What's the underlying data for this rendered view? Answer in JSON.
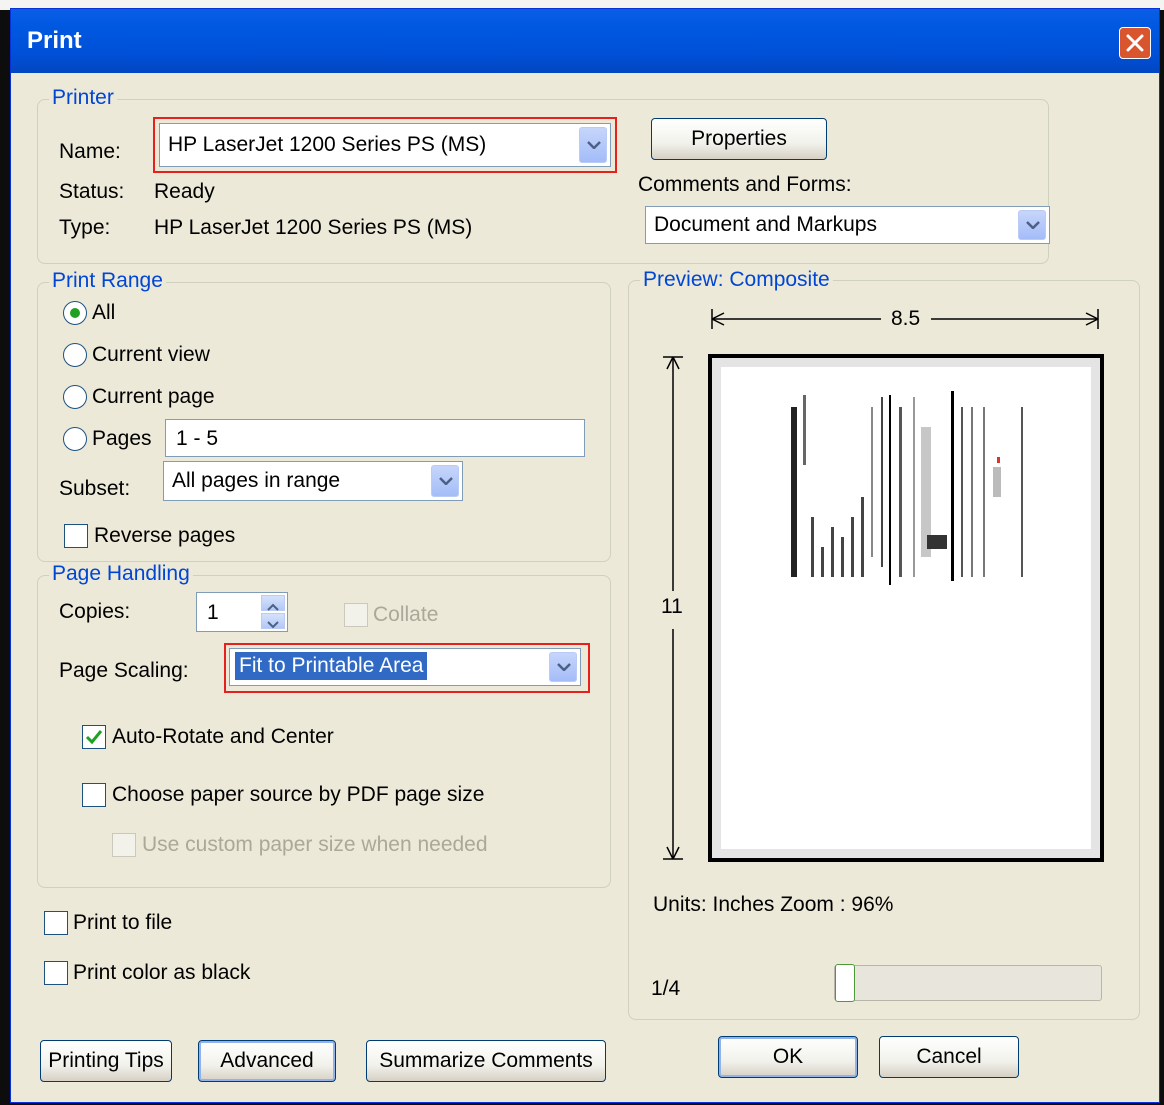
{
  "dialog": {
    "title": "Print"
  },
  "printer": {
    "legend": "Printer",
    "name_label": "Name:",
    "name_value": "HP LaserJet 1200 Series PS (MS)",
    "status_label": "Status:",
    "status_value": "Ready",
    "type_label": "Type:",
    "type_value": "HP LaserJet 1200 Series PS (MS)",
    "properties_label": "Properties",
    "comments_label": "Comments and Forms:",
    "comments_value": "Document and Markups"
  },
  "print_range": {
    "legend": "Print Range",
    "all_label": "All",
    "current_view_label": "Current view",
    "current_page_label": "Current page",
    "pages_label": "Pages",
    "pages_value": "1 - 5",
    "subset_label": "Subset:",
    "subset_value": "All pages in range",
    "reverse_label": "Reverse pages",
    "selected": "All"
  },
  "page_handling": {
    "legend": "Page Handling",
    "copies_label": "Copies:",
    "copies_value": "1",
    "collate_label": "Collate",
    "scaling_label": "Page Scaling:",
    "scaling_value": "Fit to Printable Area",
    "auto_rotate_label": "Auto-Rotate and Center",
    "auto_rotate_checked": true,
    "paper_source_label": "Choose paper source by PDF page size",
    "custom_paper_label": "Use custom paper size when needed"
  },
  "options": {
    "print_to_file_label": "Print to file",
    "print_black_label": "Print color as black"
  },
  "preview": {
    "legend": "Preview: Composite",
    "width_label": "8.5",
    "height_label": "11",
    "units_zoom": "Units: Inches Zoom :  96%",
    "page_indicator": "1/4",
    "page_progress": 0.25
  },
  "buttons": {
    "printing_tips": "Printing Tips",
    "advanced": "Advanced",
    "summarize": "Summarize Comments",
    "ok": "OK",
    "cancel": "Cancel"
  },
  "colors": {
    "titlebar": "#0058e0",
    "legend": "#0046d5",
    "highlight": "#316ac5",
    "callout": "#e8201c"
  }
}
